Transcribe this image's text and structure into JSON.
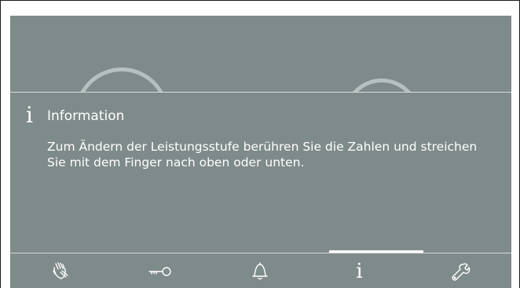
{
  "info": {
    "icon_glyph": "i",
    "title": "Information",
    "message": "Zum Ändern der Leistungsstufe berühren Sie die Zahlen und streichen Sie mit dem Finger nach oben oder unten."
  },
  "nav": {
    "items": [
      {
        "name": "wipe-protection",
        "icon": "hand-wipe-icon"
      },
      {
        "name": "lock",
        "icon": "key-icon"
      },
      {
        "name": "timer",
        "icon": "bell-icon"
      },
      {
        "name": "info",
        "icon": "info-icon",
        "glyph": "i",
        "active": true
      },
      {
        "name": "settings",
        "icon": "wrench-icon"
      }
    ]
  },
  "colors": {
    "screen": "#7f8a8b",
    "text": "#ffffff",
    "arc": "#b7c0c0",
    "divider": "#d5dada",
    "indicator": "#ffffff"
  }
}
